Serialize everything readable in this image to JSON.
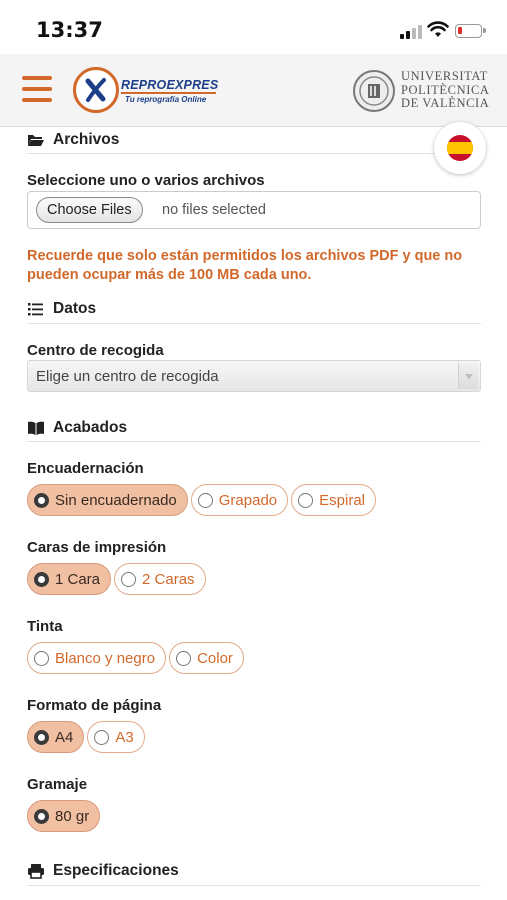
{
  "status_bar": {
    "time": "13:37"
  },
  "header": {
    "logo_name": "REPROEXPRES",
    "logo_tagline": "Tu reprografía Online",
    "university_lines": [
      "UNIVERSITAT",
      "POLITÈCNICA",
      "DE VALÈNCIA"
    ]
  },
  "sections": {
    "archivos": "Archivos",
    "datos": "Datos",
    "acabados": "Acabados",
    "especificaciones": "Especificaciones"
  },
  "files": {
    "label": "Seleccione uno o varios archivos",
    "button": "Choose Files",
    "status": "no files selected",
    "warning": "Recuerde que solo están permitidos los archivos PDF y que no pueden ocupar más de 100 MB cada uno."
  },
  "datos": {
    "centro_label": "Centro de recogida",
    "centro_value": "Elige un centro de recogida"
  },
  "acabados": {
    "encuadernacion": {
      "label": "Encuadernación",
      "options": [
        "Sin encuadernado",
        "Grapado",
        "Espiral"
      ],
      "selected": "Sin encuadernado"
    },
    "caras": {
      "label": "Caras de impresión",
      "options": [
        "1 Cara",
        "2 Caras"
      ],
      "selected": "1 Cara"
    },
    "tinta": {
      "label": "Tinta",
      "options": [
        "Blanco y negro",
        "Color"
      ],
      "selected": null
    },
    "formato": {
      "label": "Formato de página",
      "options": [
        "A4",
        "A3"
      ],
      "selected": "A4"
    },
    "gramaje": {
      "label": "Gramaje",
      "options": [
        "80 gr"
      ],
      "selected": "80 gr"
    }
  },
  "colors": {
    "accent": "#d2692b",
    "selected_pill": "#f1c0a3",
    "brand_blue": "#1d3f8a"
  },
  "language": {
    "icon": "spain-flag-icon"
  }
}
